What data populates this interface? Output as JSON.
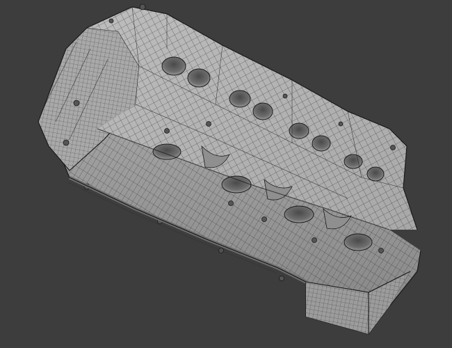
{
  "viewport": {
    "background": "#3d3d3d",
    "object": "cylinder-head-mesh",
    "shading": "wireframe-on-solid",
    "colors": {
      "surface_light": "#b3b3b3",
      "surface_mid": "#9a9a9a",
      "surface_dark": "#7a7a7a",
      "wire": "#1c1c1c"
    }
  }
}
